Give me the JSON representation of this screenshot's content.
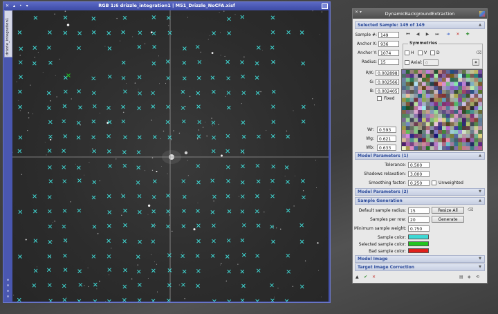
{
  "image_window": {
    "title": "RGB 1:6 drizzle_integration1 | M51_Drizzle_NoCFA.xisf",
    "side_tab": "drizzle_integration1",
    "title_icons": [
      "close-icon",
      "shade-icon",
      "pin-icon",
      "menu-icon"
    ]
  },
  "panel": {
    "title": "DynamicBackgroundExtraction",
    "selected_sample": {
      "header": "Selected Sample: 149 of 149",
      "sample_label": "Sample #:",
      "sample_value": "149",
      "anchor_x_label": "Anchor X:",
      "anchor_x_value": "936",
      "anchor_y_label": "Anchor Y:",
      "anchor_y_value": "1074",
      "radius_label": "Radius:",
      "radius_value": "15",
      "symmetries_label": "Symmetries",
      "h_label": "H",
      "v_label": "V",
      "d_label": "D",
      "axial_label": "Axial:",
      "axial_value": "0",
      "rk_label": "R/K:",
      "rk_value": "0.002898",
      "g_label": "G:",
      "g_value": "0.002566",
      "b_label": "B:",
      "b_value": "0.002405",
      "fixed_label": "Fixed",
      "wr_label": "Wr:",
      "wr_value": "0.593",
      "wg_label": "Wg:",
      "wg_value": "0.621",
      "wb_label": "Wb:",
      "wb_value": "0.633"
    },
    "model_params_1": {
      "header": "Model Parameters (1)",
      "tolerance_label": "Tolerance:",
      "tolerance_value": "0.500",
      "shadows_label": "Shadows relaxation:",
      "shadows_value": "3.000",
      "smoothing_label": "Smoothing factor:",
      "smoothing_value": "0.250",
      "unweighted_label": "Unweighted"
    },
    "model_params_2": {
      "header": "Model Parameters (2)"
    },
    "sample_generation": {
      "header": "Sample Generation",
      "default_radius_label": "Default sample radius:",
      "default_radius_value": "15",
      "resize_all_label": "Resize All",
      "per_row_label": "Samples per row:",
      "per_row_value": "20",
      "generate_label": "Generate",
      "min_weight_label": "Minimum sample weight:",
      "min_weight_value": "0.750",
      "sample_color_label": "Sample color:",
      "selected_color_label": "Selected sample color:",
      "bad_color_label": "Bad sample color:"
    },
    "model_image": {
      "header": "Model Image"
    },
    "target_correction": {
      "header": "Target Image Correction"
    }
  },
  "colors": {
    "sample": "#3fd8d4",
    "selected": "#22c41f",
    "bad": "#e0201c",
    "window_frame": "#4654b0",
    "section_text": "#2b4a9a"
  }
}
